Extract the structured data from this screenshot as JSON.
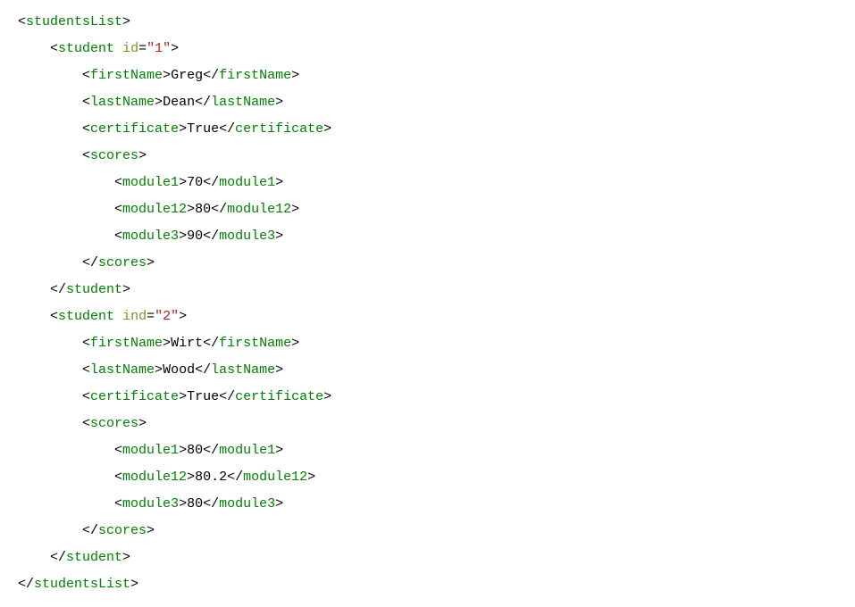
{
  "lines": [
    {
      "indent": 0,
      "parts": [
        {
          "type": "openTag",
          "tag": "studentsList"
        }
      ]
    },
    {
      "indent": 1,
      "parts": [
        {
          "type": "openTagAttr",
          "tag": "student",
          "attrName": "id",
          "attrValue": "\"1\""
        }
      ]
    },
    {
      "indent": 2,
      "parts": [
        {
          "type": "elemText",
          "tag": "firstName",
          "text": "Greg"
        }
      ]
    },
    {
      "indent": 2,
      "parts": [
        {
          "type": "elemText",
          "tag": "lastName",
          "text": "Dean"
        }
      ]
    },
    {
      "indent": 2,
      "parts": [
        {
          "type": "elemText",
          "tag": "certificate",
          "text": "True"
        }
      ]
    },
    {
      "indent": 2,
      "parts": [
        {
          "type": "openTag",
          "tag": "scores"
        }
      ]
    },
    {
      "indent": 3,
      "parts": [
        {
          "type": "elemText",
          "tag": "module1",
          "text": "70"
        }
      ]
    },
    {
      "indent": 3,
      "parts": [
        {
          "type": "elemText",
          "tag": "module12",
          "text": "80"
        }
      ]
    },
    {
      "indent": 3,
      "parts": [
        {
          "type": "elemText",
          "tag": "module3",
          "text": "90"
        }
      ]
    },
    {
      "indent": 2,
      "parts": [
        {
          "type": "closeTag",
          "tag": "scores"
        }
      ]
    },
    {
      "indent": 1,
      "parts": [
        {
          "type": "closeTag",
          "tag": "student"
        }
      ]
    },
    {
      "indent": 1,
      "parts": [
        {
          "type": "openTagAttr",
          "tag": "student",
          "attrName": "ind",
          "attrValue": "\"2\""
        }
      ]
    },
    {
      "indent": 2,
      "parts": [
        {
          "type": "elemText",
          "tag": "firstName",
          "text": "Wirt"
        }
      ]
    },
    {
      "indent": 2,
      "parts": [
        {
          "type": "elemText",
          "tag": "lastName",
          "text": "Wood"
        }
      ]
    },
    {
      "indent": 2,
      "parts": [
        {
          "type": "elemText",
          "tag": "certificate",
          "text": "True"
        }
      ]
    },
    {
      "indent": 2,
      "parts": [
        {
          "type": "openTag",
          "tag": "scores"
        }
      ]
    },
    {
      "indent": 3,
      "parts": [
        {
          "type": "elemText",
          "tag": "module1",
          "text": "80"
        }
      ]
    },
    {
      "indent": 3,
      "parts": [
        {
          "type": "elemText",
          "tag": "module12",
          "text": "80.2"
        }
      ]
    },
    {
      "indent": 3,
      "parts": [
        {
          "type": "elemText",
          "tag": "module3",
          "text": "80"
        }
      ]
    },
    {
      "indent": 2,
      "parts": [
        {
          "type": "closeTag",
          "tag": "scores"
        }
      ]
    },
    {
      "indent": 1,
      "parts": [
        {
          "type": "closeTag",
          "tag": "student"
        }
      ]
    },
    {
      "indent": 0,
      "parts": [
        {
          "type": "closeTag",
          "tag": "studentsList"
        }
      ]
    }
  ],
  "indentUnit": "    "
}
